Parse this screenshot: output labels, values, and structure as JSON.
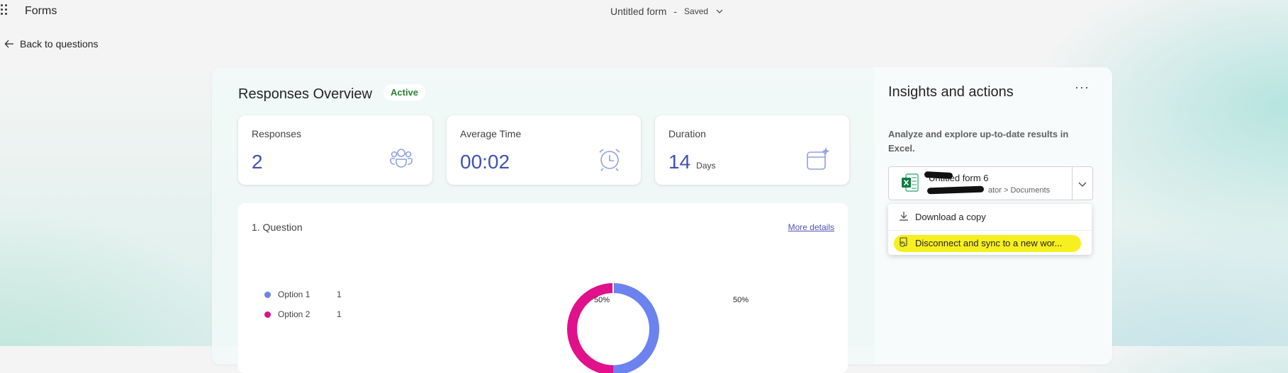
{
  "app": {
    "name": "Forms"
  },
  "header": {
    "doc_title": "Untitled form",
    "separator": "-",
    "status": "Saved"
  },
  "nav": {
    "back_label": "Back to questions"
  },
  "overview": {
    "title": "Responses Overview",
    "badge": "Active",
    "stats": [
      {
        "label": "Responses",
        "value": "2",
        "unit": "",
        "icon": "people-icon"
      },
      {
        "label": "Average Time",
        "value": "00:02",
        "unit": "",
        "icon": "alarm-clock-icon"
      },
      {
        "label": "Duration",
        "value": "14",
        "unit": "Days",
        "icon": "calendar-sparkle-icon"
      }
    ]
  },
  "question": {
    "title": "1. Question",
    "more_details": "More details",
    "options": [
      {
        "label": "Option 1",
        "count": "1",
        "color": "#6b82ef"
      },
      {
        "label": "Option 2",
        "count": "1",
        "color": "#e0118a"
      }
    ]
  },
  "chart_data": {
    "type": "pie",
    "categories": [
      "Option 1",
      "Option 2"
    ],
    "values": [
      1,
      1
    ],
    "percent_labels": [
      "50%",
      "50%"
    ],
    "colors": [
      "#6b82ef",
      "#e0118a"
    ]
  },
  "insights": {
    "title": "Insights and actions",
    "more": "···",
    "description": "Analyze and explore up-to-date results in Excel.",
    "workbook": {
      "name": "Untitled form 6",
      "path": "ator > Documents"
    },
    "menu": [
      {
        "label": "Download a copy",
        "icon": "download-icon"
      },
      {
        "label": "Disconnect and sync to a new wor...",
        "icon": "sync-workbook-icon"
      }
    ]
  }
}
